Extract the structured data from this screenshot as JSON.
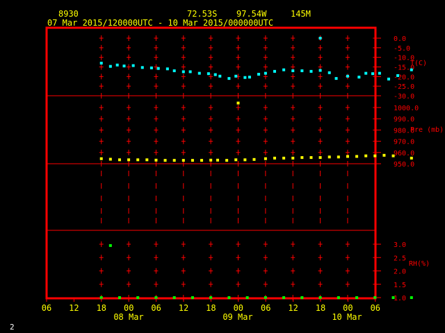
{
  "header": {
    "station": "8930",
    "lat": "72.53S",
    "lon": "97.54W",
    "elev": "145M",
    "period": "07 Mar 2015/120000UTC - 10 Mar 2015/000000UTC"
  },
  "corner_label": "2",
  "colors": {
    "frame": "#ff0000",
    "grid": "#ff0000",
    "axis_text": "#ffff00",
    "temp": "#00ffff",
    "pressure": "#ffff00",
    "rh": "#00ff00"
  },
  "chart_data": [
    {
      "type": "scatter",
      "ylabel": "T(C)",
      "ylim": [
        -30,
        0
      ],
      "yticks": [
        "0.0",
        "-5.0",
        "-10.0",
        "-15.0",
        "-20.0",
        "-25.0",
        "-30.0"
      ],
      "series": [
        {
          "points": [
            [
              12,
              -13.0
            ],
            [
              14,
              -14.7
            ],
            [
              15.5,
              -14.0
            ],
            [
              17,
              -14.5
            ],
            [
              19,
              -14.3
            ],
            [
              21,
              -15.3
            ],
            [
              23,
              -15.5
            ],
            [
              24.5,
              -15.8
            ],
            [
              26.5,
              -16.0
            ],
            [
              28,
              -17.0
            ],
            [
              30,
              -17.5
            ],
            [
              31.5,
              -17.5
            ],
            [
              33.5,
              -18.3
            ],
            [
              35.5,
              -18.5
            ],
            [
              37,
              -19.0
            ],
            [
              38,
              -19.8
            ],
            [
              40,
              -21.0
            ],
            [
              41.5,
              -19.8
            ],
            [
              43.5,
              -20.5
            ],
            [
              44.5,
              -20.3
            ],
            [
              46.5,
              -18.8
            ],
            [
              48,
              -18.3
            ],
            [
              50,
              -17.3
            ],
            [
              52,
              -16.5
            ],
            [
              54,
              -17.0
            ],
            [
              56,
              -17.0
            ],
            [
              58,
              -17.3
            ],
            [
              60,
              -16.8
            ],
            [
              62,
              -18.0
            ],
            [
              63.5,
              -21.0
            ],
            [
              66,
              -19.8
            ],
            [
              68.5,
              -20.3
            ],
            [
              70,
              -18.3
            ],
            [
              71.5,
              -18.5
            ],
            [
              73,
              -18.3
            ],
            [
              75,
              -21.3
            ],
            [
              77,
              -19.5
            ],
            [
              80,
              -16.5
            ],
            [
              60,
              0.0
            ]
          ]
        }
      ]
    },
    {
      "type": "scatter",
      "ylabel": "Pre (mb)",
      "ylim": [
        950,
        1000
      ],
      "yticks": [
        "1000.0",
        "990.0",
        "980.0",
        "970.0",
        "960.0",
        "950.0"
      ],
      "series": [
        {
          "points": [
            [
              12,
              954.5
            ],
            [
              14,
              954.0
            ],
            [
              16,
              953.5
            ],
            [
              18,
              953.5
            ],
            [
              20,
              953.5
            ],
            [
              22,
              953.5
            ],
            [
              24,
              953.2
            ],
            [
              26,
              953.0
            ],
            [
              28,
              953.0
            ],
            [
              30,
              953.0
            ],
            [
              32,
              953.0
            ],
            [
              34,
              953.0
            ],
            [
              36,
              953.2
            ],
            [
              37.5,
              953.2
            ],
            [
              39.5,
              953.0
            ],
            [
              41.5,
              953.5
            ],
            [
              43.5,
              953.5
            ],
            [
              45.5,
              953.8
            ],
            [
              48,
              954.5
            ],
            [
              50,
              955.0
            ],
            [
              52,
              955.0
            ],
            [
              54,
              955.0
            ],
            [
              56,
              955.5
            ],
            [
              58,
              955.5
            ],
            [
              60,
              955.5
            ],
            [
              62,
              956.0
            ],
            [
              64,
              956.0
            ],
            [
              66,
              956.5
            ],
            [
              68,
              956.5
            ],
            [
              70,
              957.0
            ],
            [
              72,
              957.0
            ],
            [
              74,
              957.5
            ],
            [
              76,
              957.0
            ],
            [
              80,
              955.0
            ],
            [
              42,
              1004.0
            ]
          ]
        }
      ]
    },
    {
      "type": "scatter",
      "ylabel": "RH(%)",
      "ylim": [
        1.0,
        3.0
      ],
      "yticks": [
        "3.0",
        "2.5",
        "2.0",
        "1.5",
        "1.0"
      ],
      "series": [
        {
          "points": [
            [
              14,
              2.95
            ],
            [
              12,
              1.0
            ],
            [
              16,
              1.0
            ],
            [
              20,
              1.0
            ],
            [
              24,
              1.0
            ],
            [
              28,
              1.0
            ],
            [
              32,
              1.0
            ],
            [
              36,
              1.0
            ],
            [
              40,
              1.0
            ],
            [
              44,
              1.0
            ],
            [
              48,
              1.0
            ],
            [
              52,
              1.0
            ],
            [
              56,
              1.0
            ],
            [
              60,
              1.0
            ],
            [
              64,
              1.0
            ],
            [
              68,
              1.0
            ],
            [
              72,
              1.0
            ],
            [
              76,
              1.0
            ],
            [
              80,
              1.0
            ]
          ]
        }
      ]
    }
  ],
  "x_axis": {
    "ticks": [
      "06",
      "12",
      "18",
      "00",
      "06",
      "12",
      "18",
      "00",
      "06",
      "12",
      "18",
      "00",
      "06"
    ],
    "dates": [
      "08 Mar",
      "09 Mar",
      "10 Mar"
    ]
  }
}
